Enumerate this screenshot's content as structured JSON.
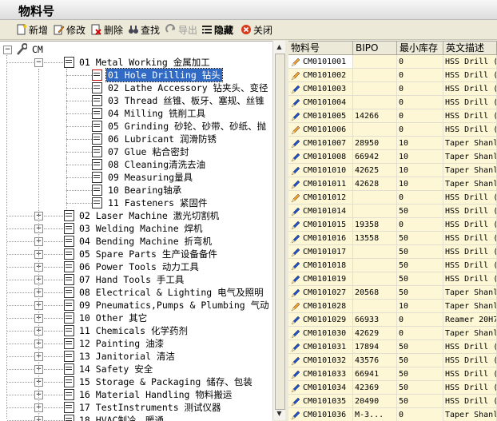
{
  "window": {
    "title": "物料号"
  },
  "toolbar": {
    "add": "新增",
    "edit": "修改",
    "delete": "删除",
    "find": "查找",
    "export": "导出",
    "hide": "隐藏",
    "close": "关闭"
  },
  "tree": {
    "root": "CM",
    "nodes": [
      {
        "label": "01 Metal Working 金属加工",
        "level": 1,
        "expanded": true
      },
      {
        "label": "01 Hole Drilling 钻头",
        "level": 2,
        "selected": true
      },
      {
        "label": "02 Lathe Accessory 钻夹头、变径",
        "level": 2
      },
      {
        "label": "03 Thread 丝锥、板牙、塞规、丝锥",
        "level": 2
      },
      {
        "label": "04 Milling  铣削工具",
        "level": 2
      },
      {
        "label": "05 Grinding 砂轮、砂带、砂纸、抛",
        "level": 2
      },
      {
        "label": "06 Lubricant 润滑防锈",
        "level": 2
      },
      {
        "label": "07 Glue 粘合密封",
        "level": 2
      },
      {
        "label": "08 Cleaning清洗去油",
        "level": 2
      },
      {
        "label": "09 Measuring量具",
        "level": 2
      },
      {
        "label": "10 Bearing轴承",
        "level": 2
      },
      {
        "label": "11 Fasteners 紧固件",
        "level": 2
      },
      {
        "label": "02 Laser Machine 激光切割机",
        "level": 1
      },
      {
        "label": "03 Welding Machine 焊机",
        "level": 1
      },
      {
        "label": "04 Bending Machine 折弯机",
        "level": 1
      },
      {
        "label": "05 Spare Parts 生产设备备件",
        "level": 1
      },
      {
        "label": "06 Power Tools 动力工具",
        "level": 1
      },
      {
        "label": "07 Hand Tools 手工具",
        "level": 1
      },
      {
        "label": "08 Electrical & Lighting 电气及照明",
        "level": 1
      },
      {
        "label": "09 Pneumatics,Pumps & Plumbing 气动",
        "level": 1
      },
      {
        "label": "10 Other 其它",
        "level": 1
      },
      {
        "label": "11 Chemicals 化学药剂",
        "level": 1
      },
      {
        "label": "12 Painting 油漆",
        "level": 1
      },
      {
        "label": "13 Janitorial 清洁",
        "level": 1
      },
      {
        "label": "14 Safety 安全",
        "level": 1
      },
      {
        "label": "15 Storage & Packaging 储存、包装",
        "level": 1
      },
      {
        "label": "16 Material Handling 物料搬运",
        "level": 1
      },
      {
        "label": "17 TestInstruments 测试仪器",
        "level": 1
      },
      {
        "label": "18 HVAC制冷、暖通",
        "level": 1
      }
    ]
  },
  "grid": {
    "columns": [
      "物料号",
      "BIPO",
      "最小库存",
      "英文描述"
    ],
    "rows": [
      {
        "code": "CM0101001",
        "bipo": "",
        "min": "0",
        "desc": "HSS Drill (",
        "icon": "orange",
        "active": true
      },
      {
        "code": "CM0101002",
        "bipo": "",
        "min": "0",
        "desc": "HSS Drill (",
        "icon": "orange"
      },
      {
        "code": "CM0101003",
        "bipo": "",
        "min": "0",
        "desc": "HSS Drill (",
        "icon": "blue"
      },
      {
        "code": "CM0101004",
        "bipo": "",
        "min": "0",
        "desc": "HSS Drill (",
        "icon": "blue"
      },
      {
        "code": "CM0101005",
        "bipo": "14266",
        "min": "0",
        "desc": "HSS Drill (",
        "icon": "blue"
      },
      {
        "code": "CM0101006",
        "bipo": "",
        "min": "0",
        "desc": "HSS Drill (",
        "icon": "orange"
      },
      {
        "code": "CM0101007",
        "bipo": "28950",
        "min": "10",
        "desc": "Taper Shanl",
        "icon": "blue"
      },
      {
        "code": "CM0101008",
        "bipo": "66942",
        "min": "10",
        "desc": "Taper Shanl",
        "icon": "blue"
      },
      {
        "code": "CM0101010",
        "bipo": "42625",
        "min": "10",
        "desc": "Taper Shanl",
        "icon": "blue"
      },
      {
        "code": "CM0101011",
        "bipo": "42628",
        "min": "10",
        "desc": "Taper Shanl",
        "icon": "blue"
      },
      {
        "code": "CM0101012",
        "bipo": "",
        "min": "0",
        "desc": "HSS Drill (",
        "icon": "orange"
      },
      {
        "code": "CM0101014",
        "bipo": "",
        "min": "50",
        "desc": "HSS Drill (",
        "icon": "blue"
      },
      {
        "code": "CM0101015",
        "bipo": "19358",
        "min": "0",
        "desc": "HSS Drill (",
        "icon": "blue"
      },
      {
        "code": "CM0101016",
        "bipo": "13558",
        "min": "50",
        "desc": "HSS Drill (",
        "icon": "blue"
      },
      {
        "code": "CM0101017",
        "bipo": "",
        "min": "50",
        "desc": "HSS Drill (",
        "icon": "blue"
      },
      {
        "code": "CM0101018",
        "bipo": "",
        "min": "50",
        "desc": "HSS Drill (",
        "icon": "blue"
      },
      {
        "code": "CM0101019",
        "bipo": "",
        "min": "50",
        "desc": "HSS Drill (",
        "icon": "blue"
      },
      {
        "code": "CM0101027",
        "bipo": "20568",
        "min": "50",
        "desc": "Taper Shanl",
        "icon": "blue"
      },
      {
        "code": "CM0101028",
        "bipo": "",
        "min": "10",
        "desc": "Taper Shanl",
        "icon": "orange"
      },
      {
        "code": "CM0101029",
        "bipo": "66933",
        "min": "0",
        "desc": "Reamer 20H7",
        "icon": "blue"
      },
      {
        "code": "CM0101030",
        "bipo": "42629",
        "min": "0",
        "desc": "Taper Shanl",
        "icon": "blue"
      },
      {
        "code": "CM0101031",
        "bipo": "17894",
        "min": "50",
        "desc": "HSS Drill (",
        "icon": "blue"
      },
      {
        "code": "CM0101032",
        "bipo": "43576",
        "min": "50",
        "desc": "HSS Drill (",
        "icon": "blue"
      },
      {
        "code": "CM0101033",
        "bipo": "66941",
        "min": "50",
        "desc": "HSS Drill (",
        "icon": "blue"
      },
      {
        "code": "CM0101034",
        "bipo": "42369",
        "min": "50",
        "desc": "HSS Drill (",
        "icon": "blue"
      },
      {
        "code": "CM0101035",
        "bipo": "20490",
        "min": "50",
        "desc": "HSS Drill (",
        "icon": "blue"
      },
      {
        "code": "CM0101036",
        "bipo": "M-3...",
        "min": "0",
        "desc": "Taper Shanl",
        "icon": "blue"
      }
    ]
  },
  "colors": {
    "selection": "#316ac5",
    "grid_row_bg": "#fdf7d5",
    "pencil_orange": "#f0a030",
    "pencil_blue": "#2050c8"
  }
}
